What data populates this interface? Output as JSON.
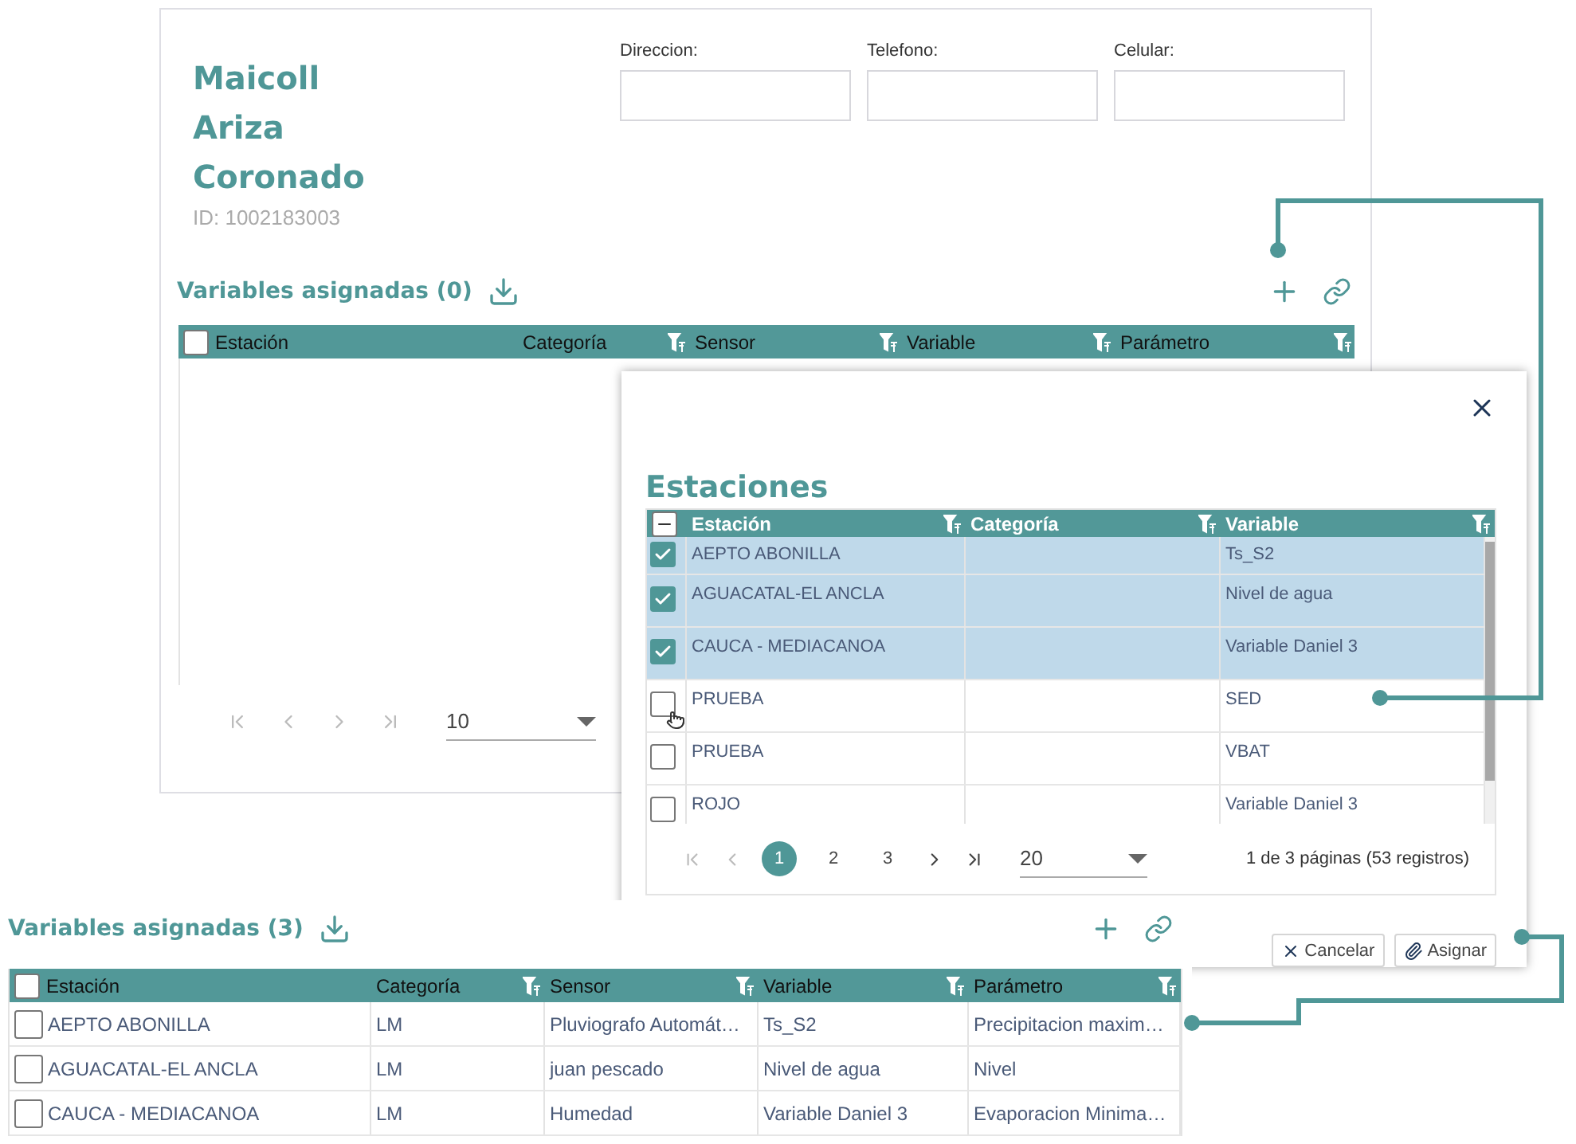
{
  "profile": {
    "name_lines": [
      "Maicoll",
      "Ariza",
      "Coronado"
    ],
    "id": "ID: 1002183003",
    "fields": [
      {
        "label": "Direccion:"
      },
      {
        "label": "Telefono:"
      },
      {
        "label": "Celular:"
      }
    ],
    "section_title": "Variables asignadas (0)",
    "columns": [
      "Estación",
      "Categoría",
      "Sensor",
      "Variable",
      "Parámetro"
    ],
    "page_size": "10",
    "header_checked": false
  },
  "dialog": {
    "title": "Estaciones",
    "header_partial": true,
    "columns": [
      "Estación",
      "Categoría",
      "Variable"
    ],
    "rows": [
      {
        "cells": [
          "AEPTO ABONILLA",
          "",
          "Ts_S2"
        ],
        "checked": true,
        "hovered": false
      },
      {
        "cells": [
          "AGUACATAL-EL ANCLA",
          "",
          "Nivel de agua"
        ],
        "checked": true,
        "hovered": false
      },
      {
        "cells": [
          "CAUCA - MEDIACANOA",
          "",
          "Variable Daniel 3"
        ],
        "checked": true,
        "hovered": false
      },
      {
        "cells": [
          "PRUEBA",
          "",
          "SED"
        ],
        "checked": false,
        "hovered": true
      },
      {
        "cells": [
          "PRUEBA",
          "",
          "VBAT"
        ],
        "checked": false,
        "hovered": false
      },
      {
        "cells": [
          "ROJO",
          "",
          "Variable Daniel 3"
        ],
        "checked": false,
        "hovered": false
      }
    ],
    "pages": [
      {
        "label": "1",
        "selected": true
      },
      {
        "label": "2",
        "selected": false
      },
      {
        "label": "3",
        "selected": false
      }
    ],
    "page_size": "20",
    "summary": "1 de 3 páginas (53 registros)",
    "buttons": [
      {
        "kind": "cancel",
        "label": "Cancelar"
      },
      {
        "kind": "assign",
        "label": "Asignar"
      }
    ]
  },
  "result": {
    "section_title": "Variables asignadas (3)",
    "header_checked": false,
    "columns": [
      "Estación",
      "Categoría",
      "Sensor",
      "Variable",
      "Parámetro"
    ],
    "rows": [
      {
        "cells": [
          "AEPTO ABONILLA",
          "LM",
          "Pluviografo Automát…",
          "Ts_S2",
          "Precipitacion maxim…"
        ],
        "checked": false
      },
      {
        "cells": [
          "AGUACATAL-EL ANCLA",
          "LM",
          "juan pescado",
          "Nivel de agua",
          "Nivel"
        ],
        "checked": false
      },
      {
        "cells": [
          "CAUCA - MEDIACANOA",
          "LM",
          "Humedad",
          "Variable Daniel 3",
          "Evaporacion Minima…"
        ],
        "checked": false
      }
    ]
  }
}
